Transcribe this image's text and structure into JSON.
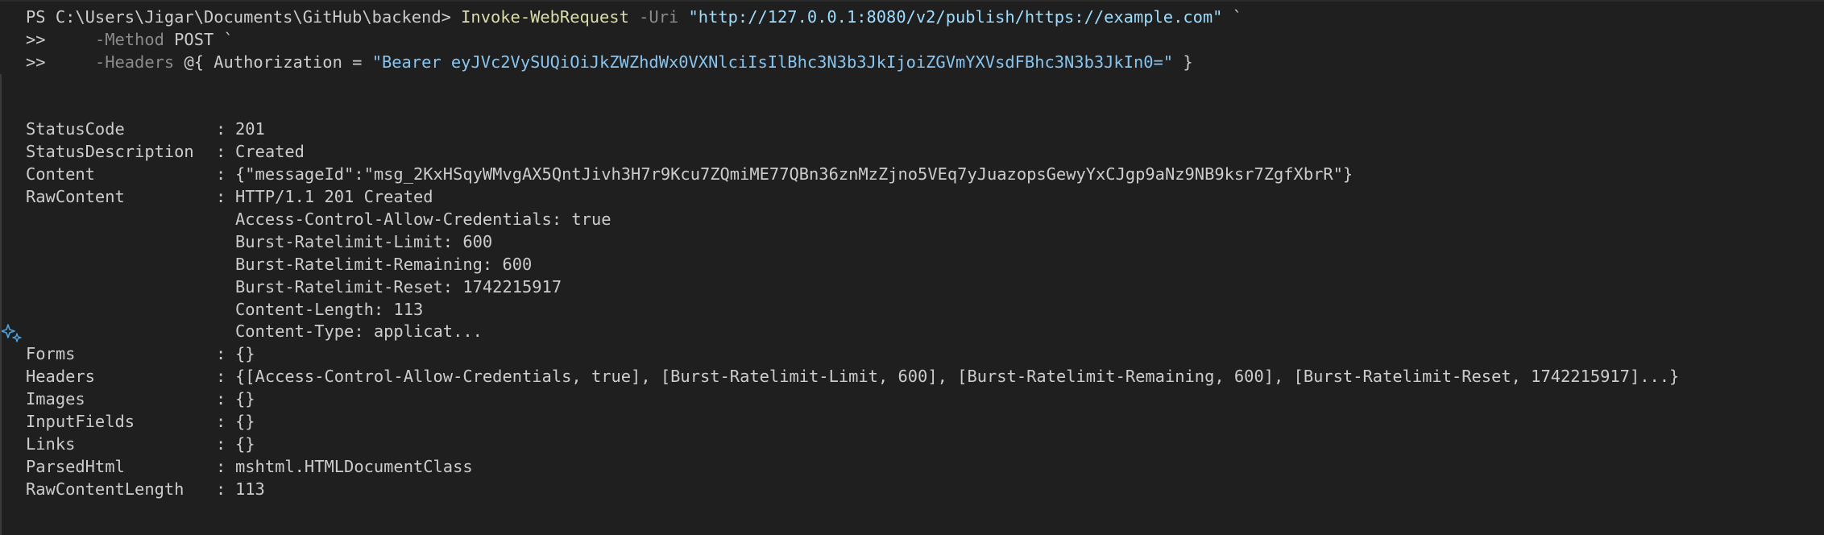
{
  "command": {
    "prompt": "PS C:\\Users\\Jigar\\Documents\\GitHub\\backend> ",
    "cmdlet": "Invoke-WebRequest",
    "uri_param": " -Uri ",
    "uri_value": "\"http://127.0.0.1:8080/v2/publish/https://example.com\"",
    "continuation": " `",
    "cont_prompt": ">>",
    "method_param": "     -Method ",
    "method_value": "POST",
    "method_tail": " `",
    "headers_param": "     -Headers ",
    "headers_open": "@{ Authorization = ",
    "headers_value": "\"Bearer eyJVc2VySUQiOiJkZWZhdWx0VXNlciIsIlBhc3N3b3JkIjoiZGVmYXVsdFBhc3N3b3JkIn0=\"",
    "headers_close": " }"
  },
  "output": {
    "separator": ": ",
    "fields": [
      {
        "key": "StatusCode",
        "value": "201"
      },
      {
        "key": "StatusDescription",
        "value": "Created"
      },
      {
        "key": "Content",
        "value": "{\"messageId\":\"msg_2KxHSqyWMvgAX5QntJivh3H7r9Kcu7ZQmiME77QBn36znMzZjno5VEq7yJuazopsGewyYxCJgp9aNz9NB9ksr7ZgfXbrR\"}"
      },
      {
        "key": "RawContent",
        "value": "HTTP/1.1 201 Created"
      }
    ],
    "raw_content_continuation": [
      "Access-Control-Allow-Credentials: true",
      "Burst-Ratelimit-Limit: 600",
      "Burst-Ratelimit-Remaining: 600",
      "Burst-Ratelimit-Reset: 1742215917",
      "Content-Length: 113",
      "Content-Type: applicat..."
    ],
    "fields_after": [
      {
        "key": "Forms",
        "value": "{}"
      },
      {
        "key": "Headers",
        "value": "{[Access-Control-Allow-Credentials, true], [Burst-Ratelimit-Limit, 600], [Burst-Ratelimit-Remaining, 600], [Burst-Ratelimit-Reset, 1742215917]...}"
      },
      {
        "key": "Images",
        "value": "{}"
      },
      {
        "key": "InputFields",
        "value": "{}"
      },
      {
        "key": "Links",
        "value": "{}"
      },
      {
        "key": "ParsedHtml",
        "value": "mshtml.HTMLDocumentClass"
      },
      {
        "key": "RawContentLength",
        "value": "113"
      }
    ]
  },
  "icons": {
    "sparkle": "sparkle-icon",
    "sparkle_color": "#4fa3e0"
  },
  "colors": {
    "background": "#1f1f1f",
    "text": "#cccccc",
    "cmdlet": "#dcdcaa",
    "parameter": "#8a8a8a",
    "string": "#9cdcfe"
  }
}
